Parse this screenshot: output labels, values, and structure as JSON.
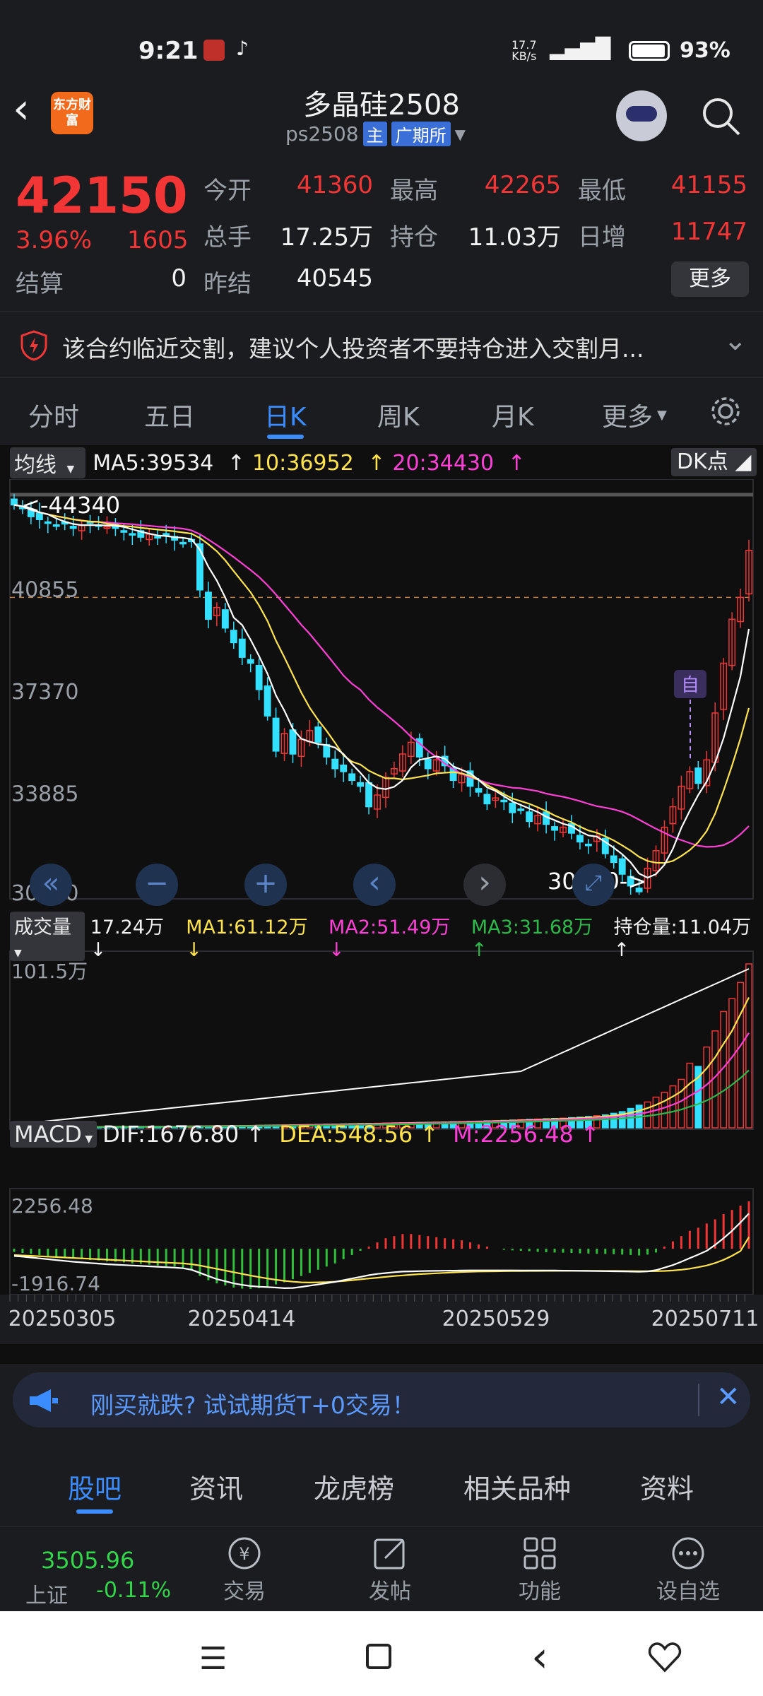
{
  "status_bar": {
    "time": "9:21",
    "net_speed": "17.7",
    "net_unit": "KB/s",
    "battery": "93%"
  },
  "header": {
    "app_badge": "东方财富",
    "title": "多晶硅2508",
    "code": "ps2508",
    "tag_main": "主",
    "tag_exchange": "广期所"
  },
  "quote": {
    "price": "42150",
    "pct": "3.96%",
    "change": "1605",
    "fields": [
      {
        "label": "今开",
        "value": "41360"
      },
      {
        "label": "最高",
        "value": "42265"
      },
      {
        "label": "最低",
        "value": "41155"
      },
      {
        "label": "总手",
        "value": "17.25万"
      },
      {
        "label": "持仓",
        "value": "11.03万"
      },
      {
        "label": "日增",
        "value": "11747"
      },
      {
        "label": "结算",
        "value": "0"
      },
      {
        "label": "昨结",
        "value": "40545"
      }
    ],
    "more_label": "更多"
  },
  "warning": {
    "text": "该合约临近交割，建议个人投资者不要持仓进入交割月..."
  },
  "period_tabs": [
    {
      "label": "分时"
    },
    {
      "label": "五日"
    },
    {
      "label": "日K"
    },
    {
      "label": "周K"
    },
    {
      "label": "月K"
    },
    {
      "label": "更多"
    }
  ],
  "chart_legend": {
    "ma_selector": "均线",
    "ma5": "MA5:39534",
    "ma10": "10:36952",
    "ma20": "20:34430",
    "dk_label": "DK点",
    "vol_selector": "成交量",
    "vol": "17.24万",
    "vol_ma1": "MA1:61.12万",
    "vol_ma2": "MA2:51.49万",
    "vol_ma3": "MA3:31.68万",
    "hold": "持仓量:11.04万",
    "macd_selector": "MACD",
    "dif": "DIF:1676.80",
    "dea": "DEA:548.56",
    "m": "M:2256.48"
  },
  "chart_data": {
    "type": "candlestick",
    "y_ticks": [
      "40855",
      "37370",
      "33885",
      "30400"
    ],
    "high_mark": "<-44340",
    "low_mark": "30400->",
    "self_mark": "自",
    "vol_max": "101.5万",
    "macd_max": "2256.48",
    "macd_min": "-1916.74",
    "x_ticks": [
      "20250305",
      "20250414",
      "20250529",
      "20250711"
    ],
    "close": [
      43700,
      43600,
      43300,
      43200,
      43100,
      43000,
      43050,
      42900,
      43000,
      43100,
      43000,
      42950,
      42900,
      42800,
      42700,
      42600,
      42700,
      42600,
      42700,
      42500,
      42400,
      42450,
      40800,
      39800,
      40200,
      39500,
      39000,
      38500,
      38300,
      37400,
      36500,
      35300,
      35900,
      35200,
      35700,
      36000,
      35600,
      35100,
      34700,
      34600,
      34300,
      34100,
      33400,
      33800,
      34400,
      34700,
      35200,
      35600,
      35100,
      34700,
      35000,
      34800,
      34300,
      34500,
      34100,
      33900,
      33500,
      33700,
      33600,
      33200,
      33300,
      32900,
      33100,
      32800,
      32600,
      32700,
      32500,
      32200,
      32100,
      32400,
      31800,
      31500,
      31100,
      30700,
      30500,
      31300,
      31900,
      32700,
      33400,
      34100,
      34600,
      34200,
      35000,
      36600,
      38300,
      39800,
      40545,
      42150
    ],
    "ma5": [
      43700,
      43650,
      43533,
      43450,
      43380,
      43240,
      43130,
      43050,
      43010,
      43010,
      43010,
      43000,
      42990,
      42950,
      42870,
      42790,
      42720,
      42660,
      42640,
      42600,
      42580,
      42530,
      42170,
      41590,
      41120,
      40540,
      39860,
      39600,
      39100,
      38540,
      37940,
      37200,
      36680,
      36060,
      35720,
      35620,
      35540,
      35500,
      35420,
      35200,
      34860,
      34560,
      34220,
      34040,
      34000,
      34080,
      34300,
      34740,
      35000,
      35060,
      35120,
      35040,
      34780,
      34660,
      34540,
      34320,
      34060,
      33940,
      33760,
      33580,
      33460,
      33340,
      33220,
      33060,
      32940,
      32820,
      32740,
      32560,
      32420,
      32380,
      32200,
      32000,
      31780,
      31500,
      31120,
      30980,
      31100,
      31420,
      31960,
      32680,
      33260,
      33800,
      34260,
      34900,
      35740,
      36780,
      37850,
      39470
    ],
    "ma10": [
      43700,
      43650,
      43533,
      43450,
      43380,
      43317,
      43264,
      43206,
      43167,
      43135,
      43125,
      43060,
      43020,
      42980,
      42960,
      42920,
      42890,
      42860,
      42830,
      42800,
      42760,
      42720,
      42570,
      42360,
      42120,
      41810,
      41440,
      41080,
      40720,
      40270,
      39740,
      39070,
      38500,
      37900,
      37300,
      36780,
      36360,
      35990,
      35580,
      35150,
      34940,
      34840,
      34630,
      34490,
      34370,
      34370,
      34330,
      34370,
      34420,
      34470,
      34540,
      34560,
      34580,
      34540,
      34450,
      34310,
      34140,
      33990,
      33830,
      33680,
      33590,
      33500,
      33380,
      33250,
      33100,
      32980,
      32870,
      32720,
      32590,
      32510,
      32390,
      32250,
      32080,
      31900,
      31690,
      31550,
      31490,
      31480,
      31550,
      31720,
      31920,
      32190,
      32570,
      33160,
      33950,
      34800,
      35730,
      36770
    ],
    "ma20": [
      43700,
      43650,
      43533,
      43450,
      43380,
      43317,
      43264,
      43206,
      43167,
      43135,
      43118,
      43100,
      43080,
      43060,
      43040,
      43010,
      42990,
      42960,
      42940,
      42920,
      42890,
      42830,
      42700,
      42520,
      42330,
      42130,
      41920,
      41700,
      41480,
      41240,
      40960,
      40640,
      40300,
      39960,
      39610,
      39300,
      38950,
      38600,
      38240,
      37880,
      37600,
      37390,
      37060,
      36790,
      36560,
      36320,
      36070,
      35790,
      35560,
      35310,
      35090,
      34870,
      34690,
      34520,
      34400,
      34320,
      34210,
      34150,
      34100,
      34050,
      34030,
      33980,
      33930,
      33850,
      33790,
      33740,
      33670,
      33590,
      33500,
      33420,
      33370,
      33310,
      33230,
      33110,
      32960,
      32800,
      32650,
      32510,
      32370,
      32260,
      32160,
      32070,
      32030,
      32040,
      32090,
      32230,
      32460,
      32740
    ],
    "volume": [
      0.5,
      0.5,
      0.5,
      0.5,
      0.5,
      0.6,
      0.6,
      0.6,
      0.6,
      0.7,
      0.7,
      0.7,
      0.7,
      0.8,
      0.8,
      0.8,
      0.8,
      0.8,
      0.9,
      0.9,
      0.9,
      1.0,
      1.2,
      1.2,
      1.1,
      1.2,
      1.3,
      1.3,
      1.4,
      1.5,
      1.6,
      1.7,
      1.7,
      1.8,
      1.9,
      2.0,
      2.1,
      2.2,
      2.3,
      2.4,
      2.5,
      2.6,
      2.7,
      2.8,
      2.9,
      3.0,
      3.1,
      3.2,
      3.3,
      3.4,
      3.5,
      3.6,
      3.8,
      3.9,
      4.0,
      4.1,
      4.3,
      4.4,
      4.6,
      4.8,
      5.0,
      5.2,
      5.4,
      5.6,
      5.8,
      6.0,
      6.3,
      6.6,
      7,
      7.5,
      8,
      9,
      10,
      12,
      14,
      16,
      19,
      22,
      26,
      30,
      40,
      38,
      50,
      60,
      72,
      80,
      90,
      101.5
    ],
    "macd_hist": [
      -150,
      -200,
      -250,
      -300,
      -350,
      -380,
      -420,
      -460,
      -500,
      -540,
      -560,
      -600,
      -620,
      -650,
      -700,
      -720,
      -760,
      -800,
      -830,
      -850,
      -900,
      -1000,
      -1300,
      -1500,
      -1650,
      -1750,
      -1850,
      -1900,
      -1916,
      -1880,
      -1800,
      -1700,
      -1600,
      -1450,
      -1300,
      -1150,
      -1000,
      -850,
      -700,
      -500,
      -300,
      -100,
      100,
      300,
      500,
      600,
      700,
      700,
      650,
      600,
      550,
      500,
      450,
      400,
      300,
      200,
      100,
      0,
      -50,
      -80,
      -100,
      -120,
      -150,
      -170,
      -180,
      -190,
      -200,
      -220,
      -230,
      -240,
      -250,
      -260,
      -280,
      -300,
      -320,
      -280,
      -180,
      100,
      350,
      600,
      850,
      1000,
      1200,
      1400,
      1650,
      1850,
      2050,
      2256
    ],
    "dif": [
      -350,
      -380,
      -420,
      -460,
      -500,
      -540,
      -580,
      -620,
      -650,
      -680,
      -710,
      -740,
      -760,
      -780,
      -800,
      -820,
      -840,
      -860,
      -880,
      -900,
      -930,
      -1000,
      -1150,
      -1300,
      -1450,
      -1550,
      -1650,
      -1720,
      -1780,
      -1810,
      -1830,
      -1850,
      -1880,
      -1870,
      -1820,
      -1760,
      -1700,
      -1640,
      -1580,
      -1500,
      -1420,
      -1340,
      -1260,
      -1200,
      -1160,
      -1120,
      -1090,
      -1080,
      -1070,
      -1060,
      -1055,
      -1050,
      -1045,
      -1040,
      -1030,
      -1030,
      -1030,
      -1030,
      -1030,
      -1030,
      -1040,
      -1040,
      -1040,
      -1040,
      -1040,
      -1045,
      -1050,
      -1055,
      -1060,
      -1065,
      -1070,
      -1075,
      -1080,
      -1090,
      -1100,
      -1080,
      -1020,
      -900,
      -780,
      -620,
      -450,
      -280,
      -100,
      180,
      500,
      850,
      1250,
      1676
    ],
    "dea": [
      -300,
      -320,
      -340,
      -360,
      -380,
      -400,
      -420,
      -440,
      -460,
      -480,
      -500,
      -520,
      -540,
      -560,
      -580,
      -600,
      -620,
      -640,
      -660,
      -680,
      -700,
      -740,
      -800,
      -880,
      -960,
      -1040,
      -1120,
      -1200,
      -1280,
      -1350,
      -1420,
      -1480,
      -1530,
      -1570,
      -1600,
      -1610,
      -1600,
      -1590,
      -1570,
      -1540,
      -1500,
      -1460,
      -1420,
      -1380,
      -1340,
      -1300,
      -1270,
      -1240,
      -1210,
      -1190,
      -1170,
      -1150,
      -1130,
      -1110,
      -1095,
      -1085,
      -1080,
      -1075,
      -1070,
      -1065,
      -1062,
      -1060,
      -1058,
      -1056,
      -1054,
      -1052,
      -1052,
      -1052,
      -1054,
      -1056,
      -1058,
      -1060,
      -1063,
      -1066,
      -1070,
      -1072,
      -1070,
      -1060,
      -1040,
      -1000,
      -950,
      -880,
      -800,
      -680,
      -530,
      -340,
      -110,
      548
    ]
  },
  "nav_buttons": {
    "first": "«",
    "zoom_out": "−",
    "zoom_in": "+",
    "prev": "‹",
    "next": "›"
  },
  "ad": {
    "text": "刚买就跌? 试试期货T+0交易！"
  },
  "sub_tabs": [
    {
      "label": "股吧"
    },
    {
      "label": "资讯"
    },
    {
      "label": "龙虎榜"
    },
    {
      "label": "相关品种"
    },
    {
      "label": "资料"
    }
  ],
  "bottom_nav": {
    "index_value": "3505.96",
    "index_name": "上证",
    "index_change": "-0.11%",
    "items": [
      {
        "label": "交易"
      },
      {
        "label": "发帖"
      },
      {
        "label": "功能"
      },
      {
        "label": "设自选"
      }
    ]
  },
  "colors": {
    "up": "#f23535",
    "down": "#33e0ff",
    "ma5": "#ffffff",
    "ma10": "#ffe34a",
    "ma20": "#ff3fd6",
    "vol_ma3": "#2db84a",
    "accent": "#3b8cff"
  }
}
